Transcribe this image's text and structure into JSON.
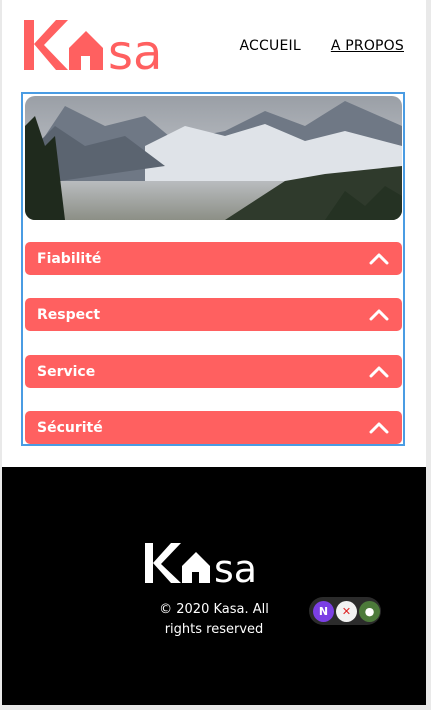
{
  "header": {
    "logo_text": "Kasa",
    "nav": [
      {
        "label": "ACCUEIL",
        "active": false
      },
      {
        "label": "A PROPOS",
        "active": true
      }
    ]
  },
  "banner": {
    "description": "mountain landscape"
  },
  "collapses": [
    {
      "title": "Fiabilité",
      "icon": "chevron-up-icon"
    },
    {
      "title": "Respect",
      "icon": "chevron-up-icon"
    },
    {
      "title": "Service",
      "icon": "chevron-up-icon"
    },
    {
      "title": "Sécurité",
      "icon": "chevron-up-icon"
    }
  ],
  "footer": {
    "logo_text": "Kasa",
    "copyright_line1": "© 2020 Kasa. All",
    "copyright_line2": "rights reserved",
    "extension_badge": "N"
  },
  "colors": {
    "accent": "#ff6060",
    "footer_bg": "#000000"
  }
}
